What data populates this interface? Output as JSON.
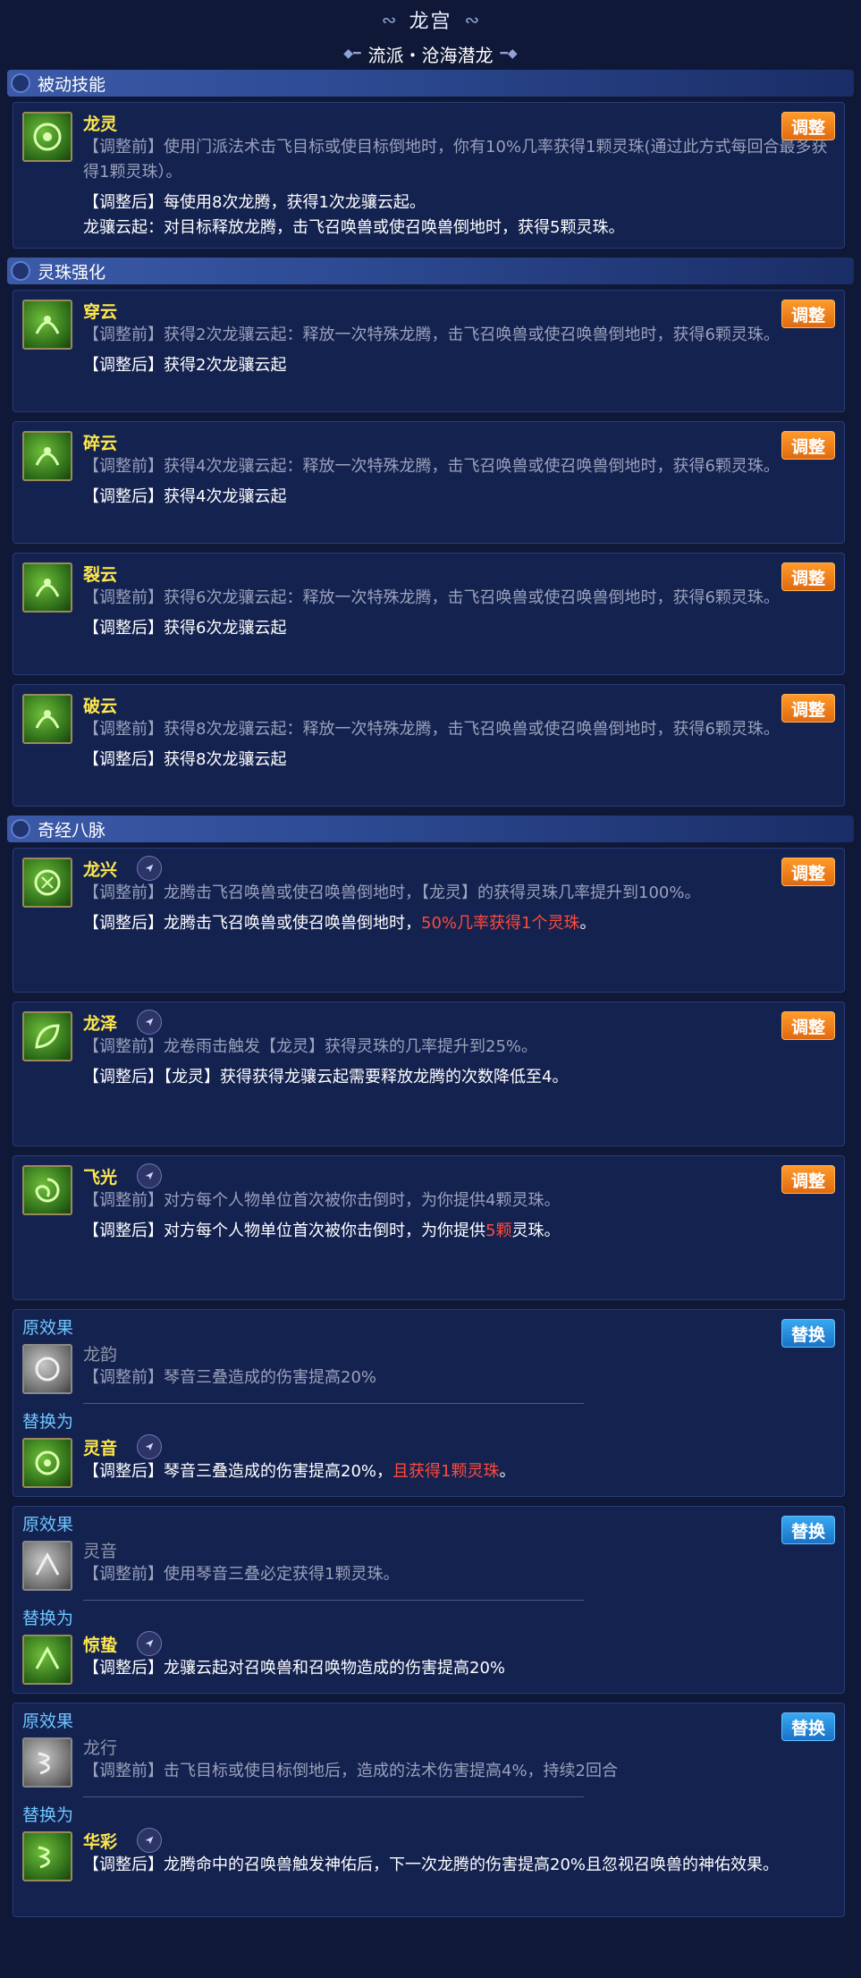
{
  "header": {
    "title": "龙宫",
    "subtitle": "流派・沧海潜龙"
  },
  "sections": {
    "passive": "被动技能",
    "bead": "灵珠强化",
    "meridian": "奇经八脉"
  },
  "buttons": {
    "adjust": "调整",
    "replace": "替换"
  },
  "labels": {
    "original": "原效果",
    "replace_with": "替换为"
  },
  "passive": [
    {
      "name": "龙灵",
      "before": "【调整前】使用门派法术击飞目标或使目标倒地时，你有10%几率获得1颗灵珠(通过此方式每回合最多获得1颗灵珠）。",
      "after1": "【调整后】每使用8次龙腾，获得1次龙骧云起。",
      "after2": "龙骧云起：对目标释放龙腾，击飞召唤兽或使召唤兽倒地时，获得5颗灵珠。"
    }
  ],
  "bead": [
    {
      "name": "穿云",
      "before": "【调整前】获得2次龙骧云起：释放一次特殊龙腾，击飞召唤兽或使召唤兽倒地时，获得6颗灵珠。",
      "after": "【调整后】获得2次龙骧云起"
    },
    {
      "name": "碎云",
      "before": "【调整前】获得4次龙骧云起：释放一次特殊龙腾，击飞召唤兽或使召唤兽倒地时，获得6颗灵珠。",
      "after": "【调整后】获得4次龙骧云起"
    },
    {
      "name": "裂云",
      "before": "【调整前】获得6次龙骧云起：释放一次特殊龙腾，击飞召唤兽或使召唤兽倒地时，获得6颗灵珠。",
      "after": "【调整后】获得6次龙骧云起"
    },
    {
      "name": "破云",
      "before": "【调整前】获得8次龙骧云起：释放一次特殊龙腾，击飞召唤兽或使召唤兽倒地时，获得6颗灵珠。",
      "after": "【调整后】获得8次龙骧云起"
    }
  ],
  "meridian": [
    {
      "name": "龙兴",
      "before": "【调整前】龙腾击飞召唤兽或使召唤兽倒地时，【龙灵】的获得灵珠几率提升到100%。",
      "after_a": "【调整后】龙腾击飞召唤兽或使召唤兽倒地时，",
      "after_hl": "50%几率获得1个灵珠",
      "after_b": "。"
    },
    {
      "name": "龙泽",
      "before": "【调整前】龙卷雨击触发【龙灵】获得灵珠的几率提升到25%。",
      "after_a": "【调整后】【龙灵】获得获得龙骧云起需要释放龙腾的次数降低至4。",
      "after_hl": "",
      "after_b": ""
    },
    {
      "name": "飞光",
      "before": "【调整前】对方每个人物单位首次被你击倒时，为你提供4颗灵珠。",
      "after_a": "【调整后】对方每个人物单位首次被你击倒时，为你提供",
      "after_hl": "5颗",
      "after_b": "灵珠。"
    }
  ],
  "replacements": [
    {
      "orig_name": "龙韵",
      "orig_text": "【调整前】琴音三叠造成的伤害提高20%",
      "new_name": "灵音",
      "new_a": "【调整后】琴音三叠造成的伤害提高20%，",
      "new_hl": "且获得1颗灵珠",
      "new_b": "。"
    },
    {
      "orig_name": "灵音",
      "orig_text": "【调整前】使用琴音三叠必定获得1颗灵珠。",
      "new_name": "惊蛰",
      "new_a": "【调整后】龙骧云起对召唤兽和召唤物造成的伤害提高20%",
      "new_hl": "",
      "new_b": ""
    },
    {
      "orig_name": "龙行",
      "orig_text": "【调整前】击飞目标或使目标倒地后，造成的法术伤害提高4%，持续2回合",
      "new_name": "华彩",
      "new_a": "【调整后】龙腾命中的召唤兽触发神佑后，下一次龙腾的伤害提高20%且忽视召唤兽的神佑效果。",
      "new_hl": "",
      "new_b": ""
    }
  ]
}
